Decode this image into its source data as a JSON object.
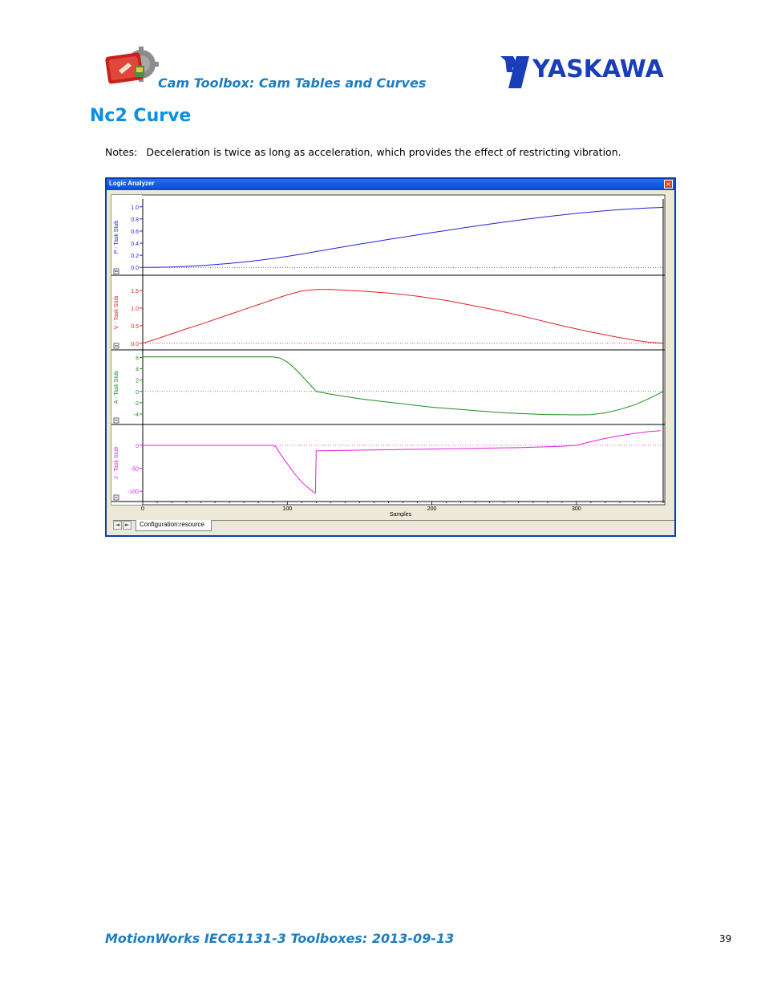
{
  "header": {
    "title": "Cam Toolbox: Cam Tables and Curves",
    "logo_text": "YASKAWA",
    "brand_color": "#1a3eb8"
  },
  "section": {
    "title": "Nc2 Curve"
  },
  "notes": {
    "label": "Notes:",
    "text": "Deceleration is twice as long as acceleration, which provides the effect of restricting vibration."
  },
  "window": {
    "title": "Logic Analyzer",
    "close_symbol": "×",
    "tab_label": "Configuration:resource",
    "nav_left": "◄",
    "nav_right": "►"
  },
  "chart_data": {
    "type": "line",
    "xlabel": "Samples",
    "x_ticks": [
      0,
      100,
      200,
      300
    ],
    "xlim": [
      0,
      360
    ],
    "panels": [
      {
        "name": "P - Task Stub",
        "color": "#2222dd",
        "ylim": [
          -0.05,
          1.05
        ],
        "y_ticks": [
          "1.0",
          "0.8",
          "0.6",
          "0.4",
          "0.2",
          "0.0"
        ],
        "y_tick_values": [
          1.0,
          0.8,
          0.6,
          0.4,
          0.2,
          0.0
        ],
        "x": [
          0,
          10,
          20,
          30,
          40,
          50,
          60,
          70,
          80,
          90,
          100,
          110,
          120,
          130,
          140,
          150,
          160,
          170,
          180,
          190,
          200,
          210,
          220,
          230,
          240,
          250,
          260,
          270,
          280,
          290,
          300,
          310,
          320,
          330,
          340,
          350,
          360
        ],
        "y": [
          0.0,
          0.002,
          0.007,
          0.016,
          0.029,
          0.045,
          0.065,
          0.089,
          0.116,
          0.147,
          0.182,
          0.221,
          0.262,
          0.303,
          0.343,
          0.383,
          0.422,
          0.461,
          0.499,
          0.537,
          0.574,
          0.61,
          0.646,
          0.681,
          0.715,
          0.748,
          0.78,
          0.81,
          0.839,
          0.866,
          0.892,
          0.915,
          0.936,
          0.954,
          0.969,
          0.982,
          0.99
        ]
      },
      {
        "name": "V - Task Stub",
        "color": "#dd2222",
        "ylim": [
          -0.05,
          1.8
        ],
        "y_ticks": [
          "1.5",
          "1.0",
          "0.5",
          "0.0"
        ],
        "y_tick_values": [
          1.5,
          1.0,
          0.5,
          0.0
        ],
        "x": [
          0,
          10,
          20,
          30,
          40,
          50,
          60,
          70,
          80,
          90,
          100,
          110,
          120,
          130,
          140,
          150,
          160,
          170,
          180,
          190,
          200,
          210,
          220,
          230,
          240,
          250,
          260,
          270,
          280,
          290,
          300,
          310,
          320,
          330,
          340,
          350,
          360
        ],
        "y": [
          0.0,
          0.13,
          0.27,
          0.41,
          0.54,
          0.68,
          0.82,
          0.96,
          1.1,
          1.24,
          1.38,
          1.49,
          1.53,
          1.53,
          1.51,
          1.49,
          1.46,
          1.43,
          1.39,
          1.34,
          1.28,
          1.22,
          1.14,
          1.06,
          0.98,
          0.89,
          0.8,
          0.7,
          0.6,
          0.5,
          0.41,
          0.32,
          0.24,
          0.16,
          0.09,
          0.03,
          0.0
        ]
      },
      {
        "name": "A - Task Stub",
        "color": "#1e8c1e",
        "ylim": [
          -5,
          6.5
        ],
        "y_ticks": [
          "6",
          "4",
          "2",
          "0",
          "-2",
          "-4"
        ],
        "y_tick_values": [
          6,
          4,
          2,
          0,
          -2,
          -4
        ],
        "x": [
          0,
          10,
          20,
          30,
          40,
          50,
          60,
          70,
          80,
          90,
          95,
          100,
          105,
          110,
          115,
          120,
          130,
          140,
          150,
          160,
          170,
          180,
          190,
          200,
          210,
          220,
          230,
          240,
          250,
          260,
          270,
          280,
          290,
          300,
          310,
          320,
          330,
          340,
          350,
          360
        ],
        "y": [
          6.1,
          6.1,
          6.1,
          6.1,
          6.1,
          6.1,
          6.1,
          6.1,
          6.1,
          6.1,
          5.9,
          5.2,
          4.1,
          2.8,
          1.4,
          0.0,
          -0.5,
          -0.9,
          -1.3,
          -1.6,
          -1.9,
          -2.2,
          -2.5,
          -2.8,
          -3.0,
          -3.2,
          -3.4,
          -3.6,
          -3.8,
          -3.9,
          -4.0,
          -4.1,
          -4.1,
          -4.15,
          -4.1,
          -3.8,
          -3.2,
          -2.4,
          -1.3,
          0.0
        ]
      },
      {
        "name": "J - Task Stub",
        "color": "#dd22dd",
        "ylim": [
          -112,
          35
        ],
        "y_ticks": [
          "0",
          "-50",
          "-100"
        ],
        "y_tick_values": [
          0,
          -50,
          -100
        ],
        "x": [
          0,
          20,
          40,
          60,
          80,
          90,
          92,
          95,
          100,
          105,
          110,
          115,
          119,
          119.5,
          120,
          140,
          160,
          180,
          200,
          220,
          240,
          260,
          280,
          290,
          300,
          310,
          320,
          330,
          340,
          350,
          358
        ],
        "y": [
          0,
          0,
          0,
          0,
          0,
          0,
          -3,
          -18,
          -40,
          -62,
          -80,
          -94,
          -104,
          -104,
          -12,
          -11,
          -10,
          -9,
          -8,
          -7,
          -6,
          -5,
          -3,
          -2,
          0,
          8,
          15,
          21,
          26,
          30,
          32
        ]
      }
    ]
  },
  "footer": {
    "document": "MotionWorks IEC61131-3 Toolboxes: 2013-09-13",
    "page_number": "39"
  }
}
